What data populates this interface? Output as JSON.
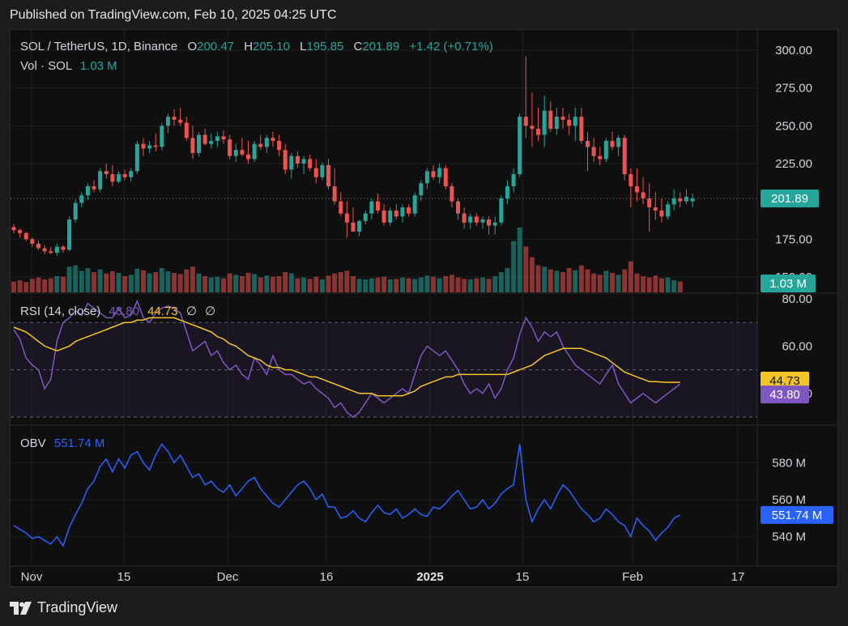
{
  "published": "Published on TradingView.com, Feb 10, 2025 04:25 UTC",
  "footer": {
    "brand": "TradingView",
    "logo_icon": "tradingview-logo-icon"
  },
  "legend": {
    "symbol": "SOL / TetherUS, 1D, Binance",
    "o_label": "O",
    "o_value": "200.47",
    "h_label": "H",
    "h_value": "205.10",
    "l_label": "L",
    "l_value": "195.85",
    "c_label": "C",
    "c_value": "201.89",
    "change": "+1.42 (+0.71%)",
    "vol_label": "Vol · SOL",
    "vol_value": "1.03 M"
  },
  "rsi_legend": {
    "label": "RSI (14, close)",
    "rsi_value": "43.80",
    "ma_value": "44.73",
    "na1": "∅",
    "na2": "∅"
  },
  "obv_legend": {
    "label": "OBV",
    "value": "551.74 M"
  },
  "colors": {
    "up": "#26a69a",
    "down": "#ef5350",
    "rsi": "#7e57c2",
    "rsi_ma": "#f5c623",
    "obv": "#2962ff",
    "background": "#0f0f0f"
  },
  "chart_data": [
    {
      "type": "candlestick",
      "title": "SOL / TetherUS, 1D, Binance",
      "x_ticks": [
        "Nov",
        "15",
        "Dec",
        "16",
        "2025",
        "15",
        "Feb",
        "17"
      ],
      "y_ticks": [
        "300.00",
        "275.00",
        "250.00",
        "225.00",
        "175.00",
        "150.00"
      ],
      "ylim": [
        150,
        300
      ],
      "last_price_label": "201.89",
      "volume_label": "1.03 M",
      "candles": [
        [
          183,
          185,
          179,
          181
        ],
        [
          181,
          182,
          176,
          179
        ],
        [
          179,
          180,
          174,
          175
        ],
        [
          175,
          176,
          170,
          172
        ],
        [
          172,
          174,
          168,
          169
        ],
        [
          169,
          171,
          165,
          167
        ],
        [
          167,
          170,
          165,
          166
        ],
        [
          166,
          172,
          164,
          170
        ],
        [
          170,
          171,
          166,
          168
        ],
        [
          168,
          190,
          167,
          188
        ],
        [
          188,
          201,
          186,
          199
        ],
        [
          199,
          206,
          196,
          204
        ],
        [
          204,
          212,
          201,
          210
        ],
        [
          210,
          214,
          206,
          208
        ],
        [
          208,
          222,
          206,
          220
        ],
        [
          220,
          225,
          215,
          218
        ],
        [
          218,
          224,
          210,
          213
        ],
        [
          213,
          220,
          212,
          218
        ],
        [
          218,
          221,
          214,
          216
        ],
        [
          216,
          222,
          213,
          220
        ],
        [
          220,
          240,
          218,
          238
        ],
        [
          238,
          242,
          230,
          235
        ],
        [
          235,
          240,
          232,
          237
        ],
        [
          237,
          245,
          233,
          236
        ],
        [
          236,
          252,
          234,
          250
        ],
        [
          250,
          258,
          245,
          256
        ],
        [
          256,
          261,
          250,
          254
        ],
        [
          254,
          262,
          250,
          252
        ],
        [
          252,
          256,
          240,
          242
        ],
        [
          242,
          250,
          228,
          232
        ],
        [
          232,
          246,
          230,
          244
        ],
        [
          244,
          248,
          237,
          238
        ],
        [
          238,
          245,
          235,
          240
        ],
        [
          240,
          246,
          236,
          243
        ],
        [
          243,
          247,
          238,
          241
        ],
        [
          241,
          244,
          228,
          230
        ],
        [
          230,
          238,
          226,
          234
        ],
        [
          234,
          242,
          230,
          231
        ],
        [
          231,
          240,
          225,
          228
        ],
        [
          228,
          240,
          226,
          238
        ],
        [
          238,
          244,
          234,
          236
        ],
        [
          236,
          244,
          232,
          242
        ],
        [
          242,
          246,
          236,
          240
        ],
        [
          240,
          244,
          230,
          234
        ],
        [
          234,
          238,
          218,
          221
        ],
        [
          221,
          232,
          215,
          230
        ],
        [
          230,
          233,
          222,
          225
        ],
        [
          225,
          230,
          218,
          228
        ],
        [
          228,
          231,
          220,
          222
        ],
        [
          222,
          228,
          212,
          216
        ],
        [
          216,
          226,
          214,
          224
        ],
        [
          224,
          228,
          208,
          210
        ],
        [
          210,
          222,
          198,
          200
        ],
        [
          200,
          206,
          190,
          192
        ],
        [
          192,
          200,
          176,
          186
        ],
        [
          186,
          196,
          182,
          180
        ],
        [
          180,
          188,
          177,
          187
        ],
        [
          187,
          194,
          185,
          192
        ],
        [
          192,
          202,
          188,
          200
        ],
        [
          200,
          205,
          192,
          194
        ],
        [
          194,
          198,
          184,
          186
        ],
        [
          186,
          196,
          184,
          194
        ],
        [
          194,
          198,
          188,
          190
        ],
        [
          190,
          198,
          186,
          196
        ],
        [
          196,
          198,
          190,
          192
        ],
        [
          192,
          206,
          190,
          204
        ],
        [
          204,
          214,
          200,
          212
        ],
        [
          212,
          222,
          208,
          220
        ],
        [
          220,
          224,
          214,
          216
        ],
        [
          216,
          225,
          212,
          222
        ],
        [
          222,
          224,
          208,
          210
        ],
        [
          210,
          212,
          196,
          200
        ],
        [
          200,
          202,
          188,
          192
        ],
        [
          192,
          196,
          182,
          186
        ],
        [
          186,
          192,
          182,
          190
        ],
        [
          190,
          192,
          184,
          186
        ],
        [
          186,
          190,
          182,
          188
        ],
        [
          188,
          190,
          178,
          184
        ],
        [
          184,
          190,
          178,
          186
        ],
        [
          186,
          204,
          184,
          202
        ],
        [
          202,
          214,
          198,
          210
        ],
        [
          210,
          222,
          206,
          218
        ],
        [
          218,
          258,
          216,
          256
        ],
        [
          256,
          296,
          242,
          250
        ],
        [
          250,
          272,
          236,
          248
        ],
        [
          248,
          262,
          240,
          244
        ],
        [
          244,
          270,
          236,
          260
        ],
        [
          260,
          266,
          246,
          248
        ],
        [
          248,
          262,
          244,
          256
        ],
        [
          256,
          262,
          248,
          254
        ],
        [
          254,
          258,
          244,
          250
        ],
        [
          250,
          262,
          240,
          256
        ],
        [
          256,
          262,
          238,
          240
        ],
        [
          240,
          246,
          220,
          236
        ],
        [
          236,
          242,
          226,
          230
        ],
        [
          230,
          236,
          224,
          228
        ],
        [
          228,
          242,
          226,
          240
        ],
        [
          240,
          246,
          234,
          236
        ],
        [
          236,
          244,
          230,
          242
        ],
        [
          242,
          244,
          214,
          218
        ],
        [
          218,
          222,
          196,
          210
        ],
        [
          210,
          222,
          200,
          206
        ],
        [
          206,
          216,
          198,
          202
        ],
        [
          202,
          212,
          180,
          196
        ],
        [
          196,
          206,
          188,
          194
        ],
        [
          194,
          202,
          186,
          190
        ],
        [
          190,
          200,
          188,
          198
        ],
        [
          198,
          208,
          194,
          202
        ],
        [
          202,
          206,
          196,
          200
        ],
        [
          200,
          208,
          198,
          203
        ],
        [
          200,
          205,
          196,
          202
        ]
      ],
      "volume": [
        40,
        45,
        38,
        50,
        55,
        48,
        52,
        60,
        58,
        95,
        100,
        80,
        90,
        75,
        85,
        70,
        78,
        72,
        60,
        65,
        88,
        82,
        70,
        75,
        90,
        78,
        72,
        68,
        85,
        95,
        70,
        60,
        55,
        58,
        52,
        70,
        65,
        60,
        72,
        68,
        55,
        62,
        58,
        60,
        75,
        70,
        52,
        55,
        50,
        58,
        48,
        62,
        70,
        75,
        80,
        60,
        50,
        48,
        52,
        55,
        58,
        48,
        50,
        55,
        52,
        50,
        55,
        62,
        58,
        52,
        60,
        65,
        55,
        50,
        48,
        52,
        55,
        50,
        60,
        75,
        90,
        190,
        240,
        170,
        130,
        100,
        95,
        85,
        80,
        75,
        90,
        82,
        100,
        85,
        70,
        65,
        80,
        72,
        65,
        85,
        115,
        70,
        60,
        55,
        62,
        52,
        55,
        45,
        40
      ]
    },
    {
      "type": "line",
      "title": "RSI (14, close)",
      "y_ticks": [
        "80.00",
        "60.00",
        "40.00"
      ],
      "ylim": [
        30,
        80
      ],
      "band": [
        30,
        70
      ],
      "midline": 50,
      "series": [
        {
          "name": "RSI",
          "values": [
            67,
            63,
            55,
            52,
            50,
            42,
            46,
            62,
            70,
            72,
            75,
            73,
            78,
            76,
            74,
            72,
            72,
            76,
            72,
            73,
            79,
            72,
            70,
            74,
            76,
            77,
            76,
            74,
            66,
            58,
            60,
            62,
            56,
            58,
            53,
            50,
            52,
            48,
            46,
            55,
            52,
            48,
            56,
            50,
            48,
            48,
            46,
            44,
            45,
            42,
            40,
            38,
            34,
            36,
            32,
            30,
            32,
            36,
            40,
            38,
            36,
            38,
            40,
            42,
            40,
            48,
            56,
            60,
            58,
            56,
            58,
            54,
            50,
            44,
            40,
            42,
            40,
            44,
            38,
            42,
            50,
            55,
            65,
            72,
            68,
            62,
            66,
            64,
            66,
            60,
            56,
            52,
            50,
            48,
            46,
            44,
            48,
            52,
            44,
            40,
            36,
            38,
            40,
            38,
            36,
            38,
            40,
            42,
            44
          ]
        },
        {
          "name": "RSI MA",
          "values": [
            68,
            67,
            66,
            64,
            62,
            60,
            59,
            58,
            59,
            60,
            62,
            63,
            64,
            65,
            66,
            67,
            68,
            69,
            70,
            70,
            71,
            71,
            72,
            72,
            72,
            72,
            72,
            71,
            70,
            69,
            68,
            67,
            66,
            64,
            63,
            61,
            60,
            58,
            56,
            55,
            54,
            52,
            51,
            51,
            50,
            50,
            49,
            48,
            47,
            47,
            46,
            45,
            44,
            43,
            42,
            41,
            40,
            40,
            40,
            39,
            39,
            39,
            39,
            39,
            40,
            41,
            43,
            44,
            45,
            46,
            47,
            47,
            48,
            48,
            48,
            48,
            48,
            48,
            48,
            48,
            48,
            49,
            50,
            51,
            52,
            54,
            56,
            57,
            58,
            59,
            59,
            59,
            59,
            58,
            57,
            56,
            55,
            53,
            51,
            49,
            48,
            47,
            46,
            45,
            45,
            44.8,
            44.7,
            44.7,
            44.73
          ]
        }
      ]
    },
    {
      "type": "line",
      "title": "OBV",
      "y_ticks": [
        "580 M",
        "560 M",
        "540 M"
      ],
      "ylim": [
        525,
        595
      ],
      "series": [
        {
          "name": "OBV",
          "values": [
            546,
            544,
            542,
            539,
            540,
            538,
            536,
            540,
            535,
            545,
            552,
            558,
            566,
            570,
            578,
            582,
            575,
            582,
            577,
            584,
            586,
            580,
            576,
            584,
            590,
            586,
            580,
            584,
            578,
            572,
            574,
            568,
            570,
            566,
            564,
            568,
            562,
            566,
            570,
            572,
            566,
            562,
            558,
            556,
            560,
            564,
            568,
            570,
            566,
            560,
            563,
            556,
            556,
            550,
            551,
            554,
            550,
            548,
            553,
            557,
            553,
            552,
            555,
            550,
            552,
            555,
            552,
            551,
            556,
            555,
            558,
            562,
            565,
            560,
            555,
            556,
            560,
            555,
            558,
            563,
            566,
            568,
            590,
            560,
            548,
            555,
            560,
            555,
            562,
            568,
            565,
            560,
            555,
            552,
            548,
            550,
            555,
            552,
            548,
            546,
            540,
            550,
            546,
            543,
            538,
            542,
            545,
            550,
            551.74
          ]
        }
      ]
    }
  ]
}
